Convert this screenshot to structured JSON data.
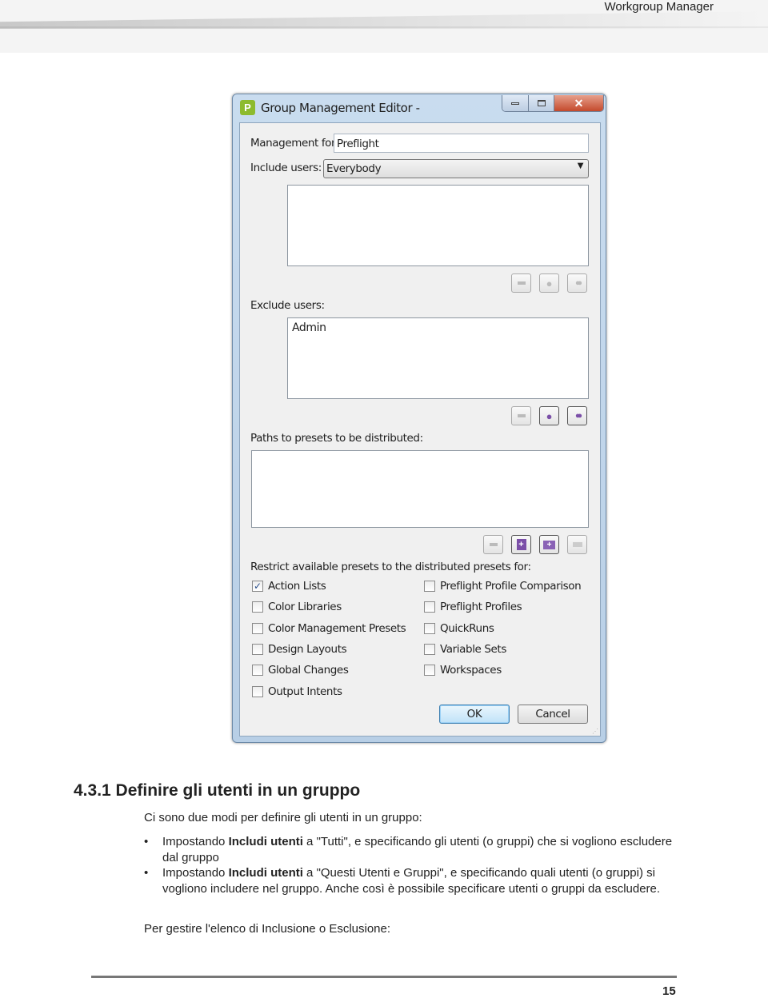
{
  "header": {
    "title": "Workgroup Manager"
  },
  "dialog": {
    "title": "Group Management Editor -",
    "management_for_label": "Management for",
    "management_for_value": "Preflight",
    "include_users_label": "Include users:",
    "include_users_value": "Everybody",
    "include_users_list": [],
    "exclude_users_label": "Exclude users:",
    "exclude_users_list": [
      "Admin"
    ],
    "paths_label": "Paths to presets to be distributed:",
    "paths_list": [],
    "restrict_label": "Restrict available presets to the distributed presets for:",
    "checkboxes_left": [
      {
        "label": "Action Lists",
        "checked": true
      },
      {
        "label": "Color Libraries",
        "checked": false
      },
      {
        "label": "Color Management Presets",
        "checked": false
      },
      {
        "label": "Design Layouts",
        "checked": false
      },
      {
        "label": "Global Changes",
        "checked": false
      },
      {
        "label": "Output Intents",
        "checked": false
      }
    ],
    "checkboxes_right": [
      {
        "label": "Preflight Profile Comparison",
        "checked": false
      },
      {
        "label": "Preflight Profiles",
        "checked": false
      },
      {
        "label": "QuickRuns",
        "checked": false
      },
      {
        "label": "Variable Sets",
        "checked": false
      },
      {
        "label": "Workspaces",
        "checked": false
      }
    ],
    "ok_label": "OK",
    "cancel_label": "Cancel",
    "accent": "#3c9be0"
  },
  "section": {
    "heading": "4.3.1 Definire gli utenti in un gruppo",
    "intro": "Ci sono due modi per definire gli utenti in un gruppo:",
    "bullets": [
      {
        "pre": "Impostando ",
        "bold": "Includi utenti",
        "post": " a \"Tutti\", e specificando gli utenti (o gruppi) che si vogliono escludere dal gruppo"
      },
      {
        "pre": "Impostando ",
        "bold": "Includi utenti",
        "post": " a \"Questi Utenti e Gruppi\", e specificando quali utenti (o gruppi) si vogliono includere nel gruppo. Anche così è possibile specificare utenti o gruppi da escludere."
      }
    ],
    "outro": "Per gestire l'elenco di Inclusione o Esclusione:"
  },
  "footer": {
    "page_number": "15"
  }
}
